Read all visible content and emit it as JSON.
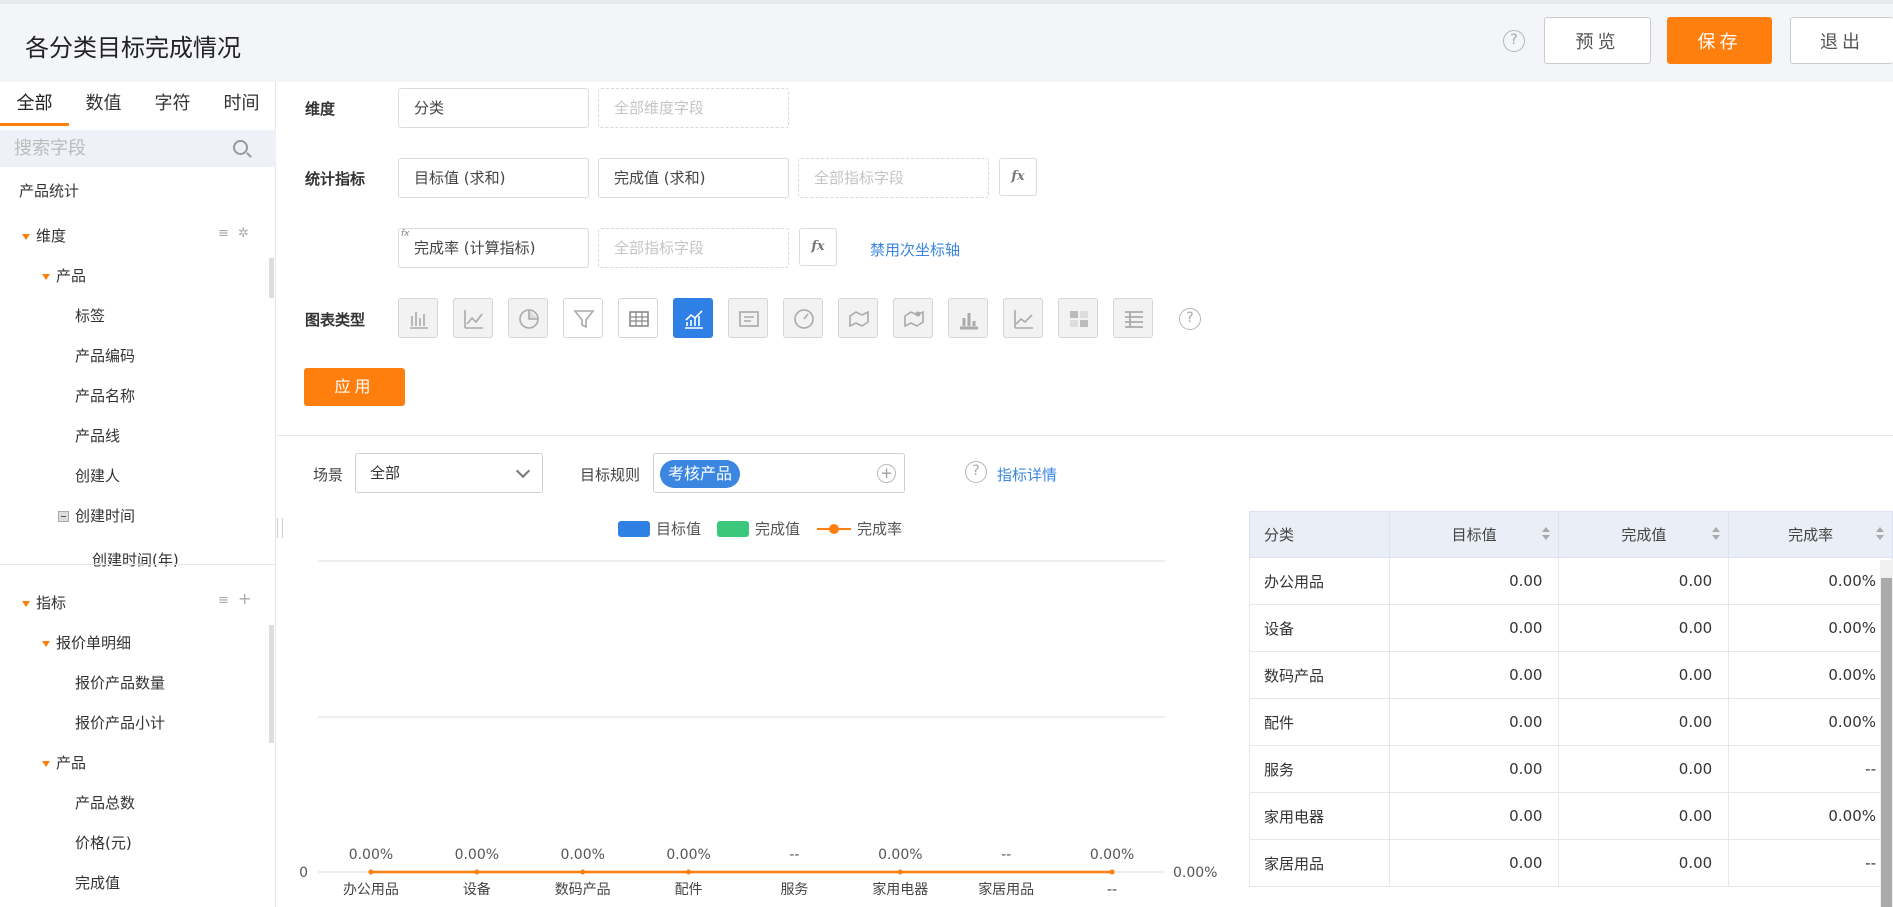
{
  "header": {
    "title": "各分类目标完成情况",
    "help_glyph": "?",
    "preview_label": "预览",
    "save_label": "保存",
    "exit_label": "退出"
  },
  "sidebar": {
    "tabs": [
      "全部",
      "数值",
      "字符",
      "时间"
    ],
    "search_placeholder": "搜索字段",
    "section_title": "产品统计",
    "dimension_group": "维度",
    "dimension_product": "产品",
    "dimension_fields": [
      "标签",
      "产品编码",
      "产品名称",
      "产品线",
      "创建人"
    ],
    "created_time": "创建时间",
    "created_time_year": "创建时间(年)",
    "metric_group": "指标",
    "metric_quote": "报价单明细",
    "metric_quote_fields": [
      "报价产品数量",
      "报价产品小计"
    ],
    "metric_product": "产品",
    "metric_product_fields": [
      "产品总数",
      "价格(元)",
      "完成值"
    ]
  },
  "config": {
    "dimension_label": "维度",
    "dimension_value": "分类",
    "dimension_placeholder": "全部维度字段",
    "metric_label": "统计指标",
    "metric_1": "目标值 (求和)",
    "metric_2": "完成值 (求和)",
    "metric_placeholder": "全部指标字段",
    "calc_metric": "完成率 (计算指标)",
    "calc_placeholder": "全部指标字段",
    "fx_label": "fx",
    "disable_secondary_axis": "禁用次坐标轴",
    "chart_type_label": "图表类型",
    "apply_label": "应用"
  },
  "filters": {
    "scene_label": "场景",
    "scene_value": "全部",
    "target_rule_label": "目标规则",
    "target_rule_tag": "考核产品",
    "metric_detail_link": "指标详情"
  },
  "chart_data": {
    "type": "bar",
    "categories": [
      "办公用品",
      "设备",
      "数码产品",
      "配件",
      "服务",
      "家用电器",
      "家居用品",
      "--"
    ],
    "series": [
      {
        "name": "目标值",
        "values": [
          0,
          0,
          0,
          0,
          0,
          0,
          0,
          0
        ],
        "color": "#2f80e4"
      },
      {
        "name": "完成值",
        "values": [
          0,
          0,
          0,
          0,
          0,
          0,
          0,
          0
        ],
        "color": "#3cc87a"
      },
      {
        "name": "完成率",
        "type": "line",
        "values": [
          0,
          0,
          0,
          0,
          null,
          0,
          null,
          0
        ],
        "color": "#ff7f0e"
      }
    ],
    "data_labels": [
      "0.00%",
      "0.00%",
      "0.00%",
      "0.00%",
      "--",
      "0.00%",
      "--",
      "0.00%"
    ],
    "y_left_tick": "0",
    "y_right_tick": "0.00%",
    "grid": true,
    "legend": "top"
  },
  "table": {
    "headers": [
      "分类",
      "目标值",
      "完成值",
      "完成率"
    ],
    "rows": [
      [
        "办公用品",
        "0.00",
        "0.00",
        "0.00%"
      ],
      [
        "设备",
        "0.00",
        "0.00",
        "0.00%"
      ],
      [
        "数码产品",
        "0.00",
        "0.00",
        "0.00%"
      ],
      [
        "配件",
        "0.00",
        "0.00",
        "0.00%"
      ],
      [
        "服务",
        "0.00",
        "0.00",
        "--"
      ],
      [
        "家用电器",
        "0.00",
        "0.00",
        "0.00%"
      ],
      [
        "家居用品",
        "0.00",
        "0.00",
        "--"
      ]
    ]
  },
  "colors": {
    "accent": "#ff7f0e",
    "primary": "#2f80e4",
    "success": "#3cc87a"
  }
}
